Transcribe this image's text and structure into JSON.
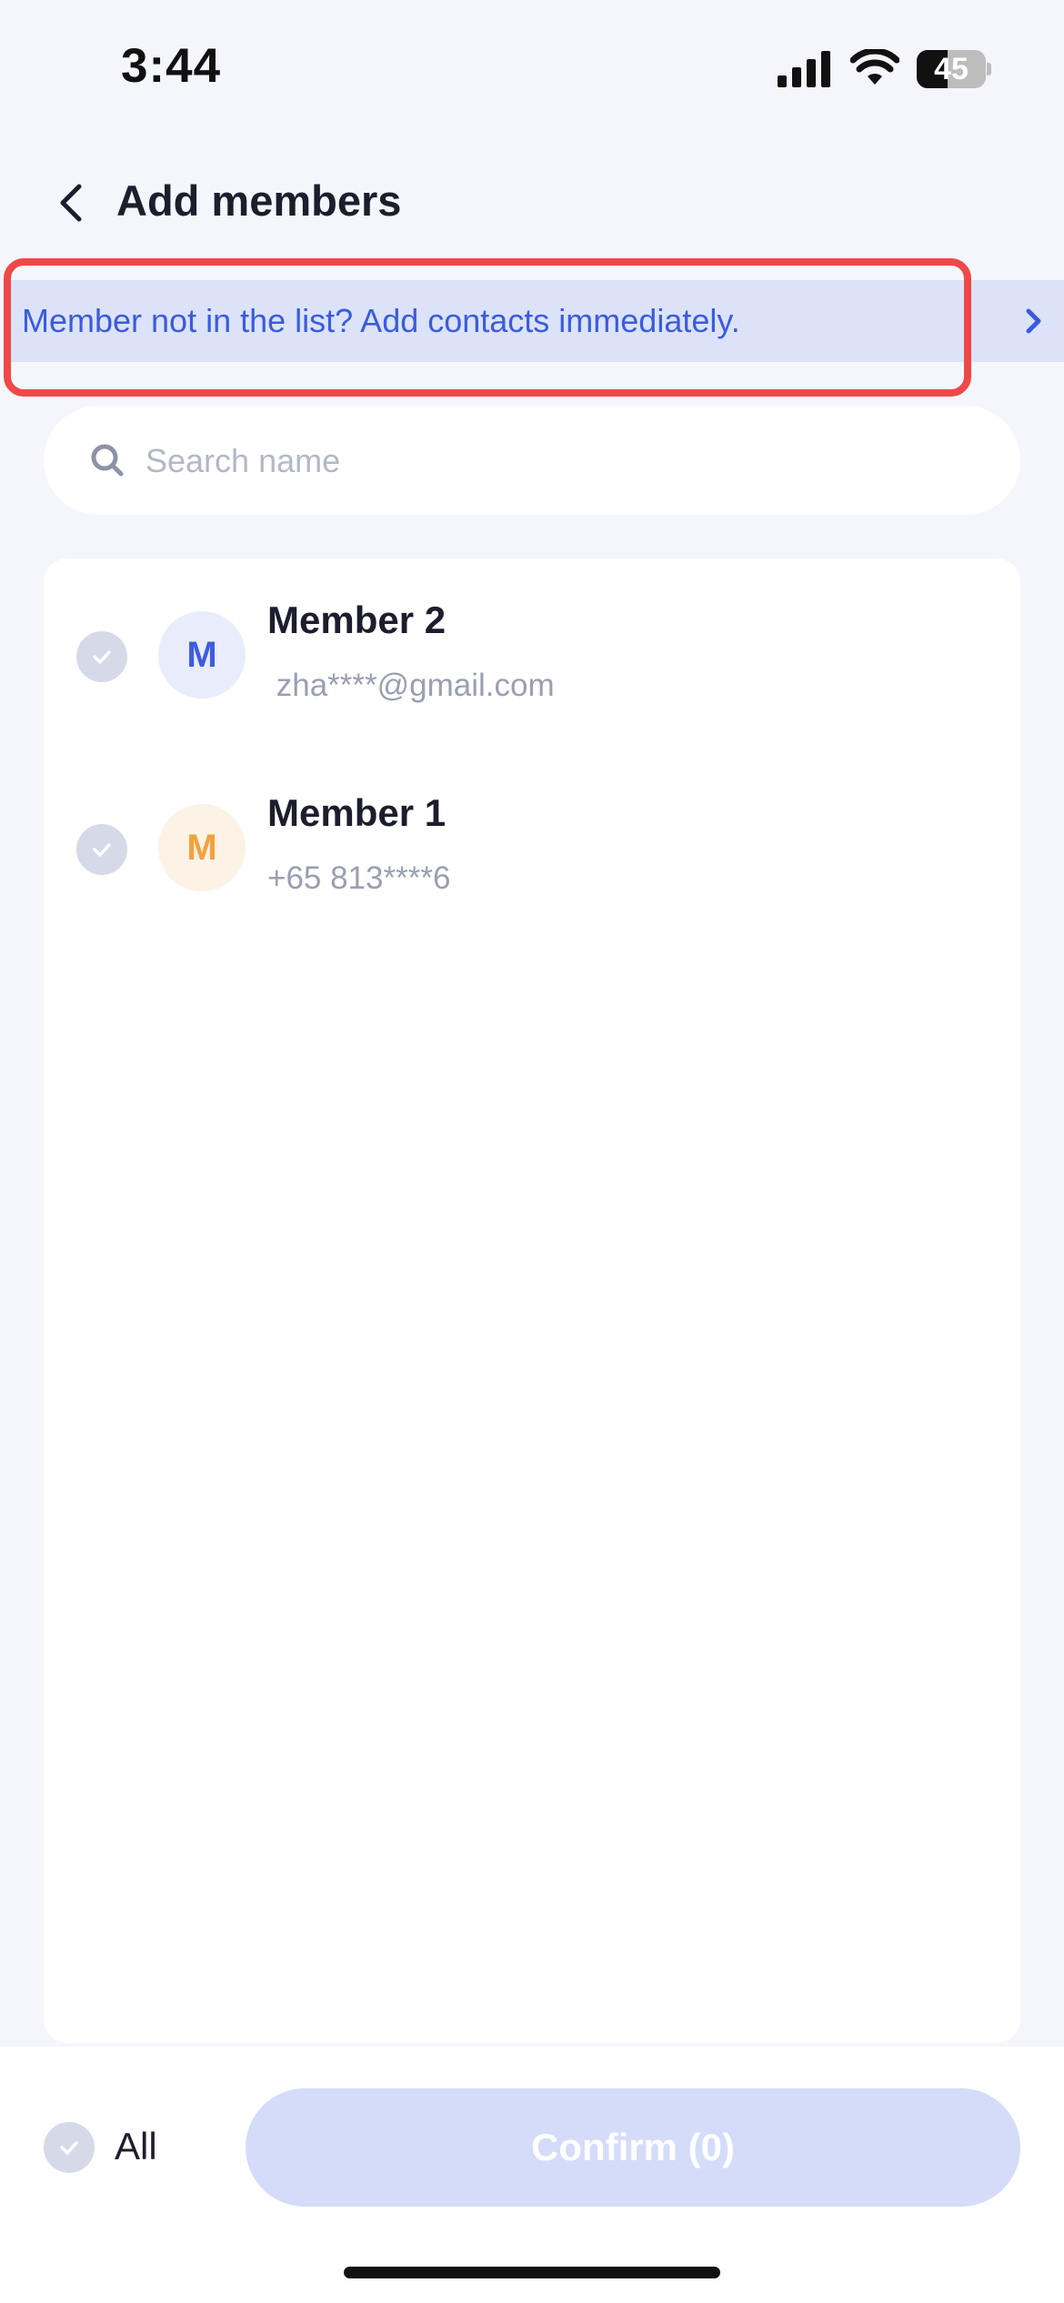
{
  "status_bar": {
    "time": "3:44",
    "battery_level": "45",
    "battery_fraction": 0.45,
    "icons": [
      "signal-icon",
      "wifi-icon",
      "battery-icon"
    ]
  },
  "header": {
    "title": "Add members",
    "back_icon": "chevron-left-icon"
  },
  "banner": {
    "text": "Member not in the list? Add contacts immediately.",
    "icon": "chevron-right-icon",
    "highlighted": true,
    "highlight_color": "#EF4848"
  },
  "search": {
    "placeholder": "Search name",
    "value": "",
    "icon": "search-icon"
  },
  "members": [
    {
      "initial": "M",
      "name": "Member 2",
      "contact": " zha****@gmail.com",
      "checked": false,
      "avatar_bg": "#E9EDFB",
      "avatar_color": "#3D5CE0"
    },
    {
      "initial": "M",
      "name": "Member 1",
      "contact": "+65 813****6",
      "checked": false,
      "avatar_bg": "#FDF2E6",
      "avatar_color": "#F2A23C"
    }
  ],
  "footer": {
    "select_all_label": "All",
    "select_all_checked": false,
    "confirm_label": "Confirm (0)",
    "confirm_enabled": false
  },
  "colors": {
    "accent": "#3A5BE0",
    "page_background": "#F4F6FC",
    "banner_background": "#DCE3F9",
    "confirm_disabled": "#D4DCFA",
    "check_inactive": "#D6D9E8",
    "secondary_text": "#9A9FB2"
  }
}
